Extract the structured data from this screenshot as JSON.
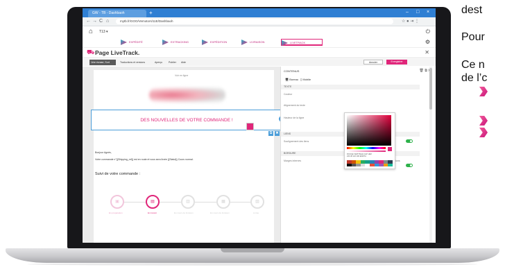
{
  "browser": {
    "tab_title": "GW - TB - Dashbaoh",
    "url": "mytb.fr/GOO/Vemotors/11E/Dashbaoh",
    "new_tab": "+",
    "minimize": "–",
    "maximize": "□",
    "close": "×",
    "back": "←",
    "forward": "→",
    "reload": "C",
    "home": "⌂",
    "menu_icons": "☆ ● ⇥ ⋮"
  },
  "app": {
    "id_label": "T13 ▾",
    "steps": [
      "EXPÉDITÉ",
      "EXTRACKING",
      "EXPÉDITION",
      "LIVRAISON",
      "LIVETRACK"
    ],
    "page_title": "Page LiveTrack.",
    "toolbar": {
      "select_label": "1ère écrase, Sort (Auto)(3) ▾",
      "items": [
        "Traductions et versions",
        "Aperçu",
        "Publier",
        "Aide"
      ],
      "btn_secondary": "Annuler",
      "btn_primary": "Enregistrer"
    }
  },
  "canvas": {
    "top_small": "Voir en ligne",
    "banner": "DES NOUVELLES DE VOTRE COMMANDE !",
    "greeting": "Bonjour Agnès,",
    "body": "Votre commande n°{{Shipping_ref}} est en route et vous sera livrée {{Statut}} Cours normal.",
    "suivi_title": "Suivi de votre commande :",
    "steps": [
      "En préparation",
      "En transit",
      "En cours de livraison",
      "En cours de livraison",
      "Livrée"
    ]
  },
  "panel": {
    "header": "CONTENUS",
    "tabs": [
      "Bureau",
      "Mobile"
    ],
    "sections": [
      "TEXTE",
      "LIENS",
      "BORDURE"
    ],
    "labels": [
      "Couleur",
      "Alignement du texte",
      "Hauteur de la ligne",
      "Soulignement des liens",
      "Marges internes",
      "Plus d'options"
    ]
  },
  "picker": {
    "fields": "ROUGE  VERT  BLEU  ALP  HEX",
    "values": "224  38  122  100  E0267A"
  },
  "doc": {
    "line1": "dest",
    "line2": "Pour",
    "line3": "Ce n",
    "line4": "de l’c"
  },
  "colors": {
    "accent": "#e0267a",
    "chrome": "#2f7fd3",
    "info": "#4a9dd9",
    "toggle": "#2eb24b"
  }
}
